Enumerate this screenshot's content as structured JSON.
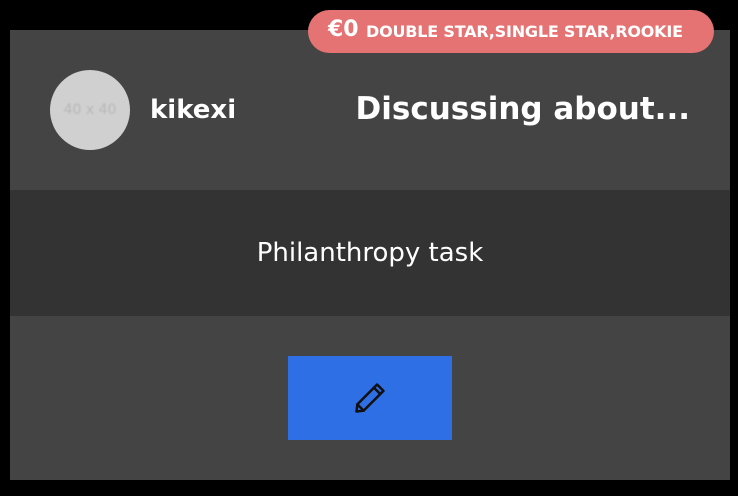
{
  "user": {
    "avatar_placeholder": "40 x 40",
    "name": "kikexi"
  },
  "header": {
    "title": "Discussing about..."
  },
  "task": {
    "name": "Philanthropy task"
  },
  "actions": {
    "edit_icon": "pencil-icon"
  },
  "badge": {
    "amount": "€0",
    "levels": "DOUBLE STAR,SINGLE STAR,ROOKIE"
  },
  "colors": {
    "background": "#000000",
    "card": "#444444",
    "task_band": "#333333",
    "button": "#2f6fe6",
    "badge": "#e57373"
  }
}
